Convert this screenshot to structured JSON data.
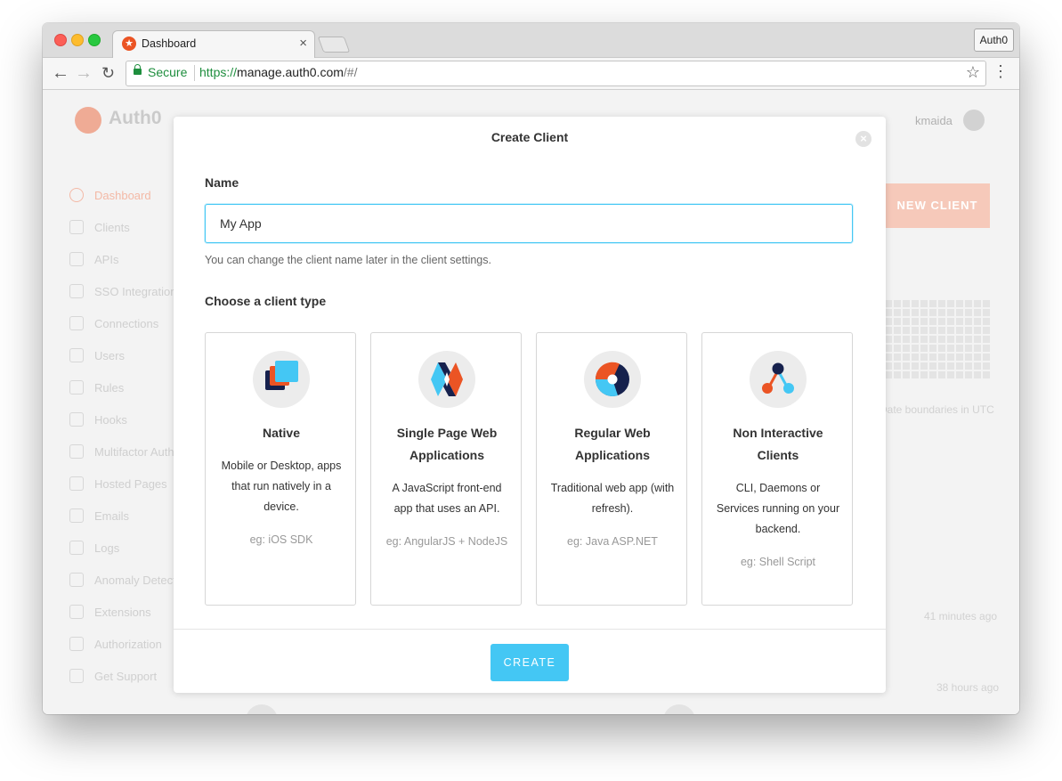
{
  "browser": {
    "tab_title": "Dashboard",
    "tab_close": "×",
    "profile_label": "Auth0",
    "secure_label": "Secure",
    "url_scheme": "https://",
    "url_host": "manage.auth0.com",
    "url_path": "/#/"
  },
  "background": {
    "logo_text": "Auth0",
    "username": "kmaida",
    "new_client_label": "NEW CLIENT",
    "sidebar_items": [
      {
        "label": "Dashboard",
        "active": true
      },
      {
        "label": "Clients"
      },
      {
        "label": "APIs"
      },
      {
        "label": "SSO Integrations"
      },
      {
        "label": "Connections"
      },
      {
        "label": "Users"
      },
      {
        "label": "Rules"
      },
      {
        "label": "Hooks"
      },
      {
        "label": "Multifactor Auth"
      },
      {
        "label": "Hosted Pages"
      },
      {
        "label": "Emails"
      },
      {
        "label": "Logs"
      },
      {
        "label": "Anomaly Detection"
      },
      {
        "label": "Extensions"
      },
      {
        "label": "Authorization"
      },
      {
        "label": "Get Support"
      }
    ],
    "faded_text_1": "Date boundaries in UTC",
    "faded_text_2": "41 minutes ago",
    "faded_text_3": "38 hours ago"
  },
  "modal": {
    "title": "Create Client",
    "close_glyph": "×",
    "name_label": "Name",
    "name_value": "My App",
    "name_hint": "You can change the client name later in the client settings.",
    "type_label": "Choose a client type",
    "create_label": "CREATE",
    "client_types": [
      {
        "title": "Native",
        "description": "Mobile or Desktop, apps that run natively in a device.",
        "example": "eg: iOS SDK",
        "icon": "native-app-icon"
      },
      {
        "title": "Single Page Web Applications",
        "description": "A JavaScript front-end app that uses an API.",
        "example": "eg: AngularJS + NodeJS",
        "icon": "spa-icon"
      },
      {
        "title": "Regular Web Applications",
        "description": "Traditional web app (with refresh).",
        "example": "eg: Java ASP.NET",
        "icon": "regular-web-app-icon"
      },
      {
        "title": "Non Interactive Clients",
        "description": "CLI, Daemons or Services running on your backend.",
        "example": "eg: Shell Script",
        "icon": "non-interactive-client-icon"
      }
    ]
  },
  "colors": {
    "accent": "#44c7f4",
    "brand": "#eb5424",
    "navy": "#16214d"
  }
}
